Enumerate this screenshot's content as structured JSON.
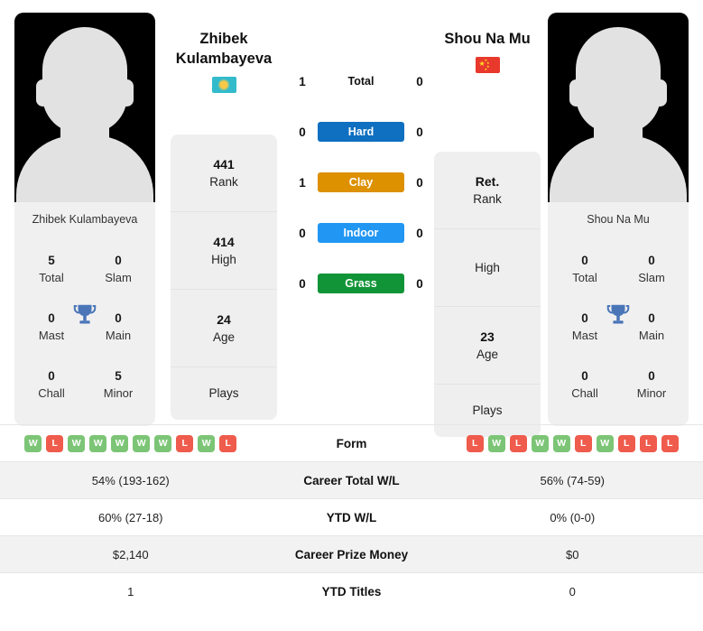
{
  "players": {
    "left": {
      "name_line1": "Zhibek",
      "name_line2": "Kulambayeva",
      "full_name": "Zhibek Kulambayeva",
      "photo_caption": "Zhibek Kulambayeva",
      "flag": "kazakhstan-flag",
      "titles": {
        "total_value": "5",
        "total_label": "Total",
        "slam_value": "0",
        "slam_label": "Slam",
        "mast_value": "0",
        "mast_label": "Mast",
        "main_value": "0",
        "main_label": "Main",
        "chall_value": "0",
        "chall_label": "Chall",
        "minor_value": "5",
        "minor_label": "Minor"
      },
      "ranks": {
        "rank_value": "441",
        "rank_label": "Rank",
        "high_value": "414",
        "high_label": "High",
        "age_value": "24",
        "age_label": "Age",
        "plays_value": "",
        "plays_label": "Plays"
      },
      "form": [
        "W",
        "L",
        "W",
        "W",
        "W",
        "W",
        "W",
        "L",
        "W",
        "L"
      ],
      "career_total_wl": "54% (193-162)",
      "ytd_wl": "60% (27-18)",
      "career_prize_money": "$2,140",
      "ytd_titles": "1"
    },
    "right": {
      "name_line1": "Shou Na Mu",
      "name_line2": "",
      "full_name": "Shou Na Mu",
      "photo_caption": "Shou Na Mu",
      "flag": "china-flag",
      "titles": {
        "total_value": "0",
        "total_label": "Total",
        "slam_value": "0",
        "slam_label": "Slam",
        "mast_value": "0",
        "mast_label": "Mast",
        "main_value": "0",
        "main_label": "Main",
        "chall_value": "0",
        "chall_label": "Chall",
        "minor_value": "0",
        "minor_label": "Minor"
      },
      "ranks": {
        "rank_value": "Ret.",
        "rank_label": "Rank",
        "high_value": "",
        "high_label": "High",
        "age_value": "23",
        "age_label": "Age",
        "plays_value": "",
        "plays_label": "Plays"
      },
      "form": [
        "L",
        "W",
        "L",
        "W",
        "W",
        "L",
        "W",
        "L",
        "L",
        "L"
      ],
      "career_total_wl": "56% (74-59)",
      "ytd_wl": "0% (0-0)",
      "career_prize_money": "$0",
      "ytd_titles": "0"
    }
  },
  "h2h": {
    "rows": [
      {
        "label": "Total",
        "left": "1",
        "right": "0",
        "color": ""
      },
      {
        "label": "Hard",
        "left": "0",
        "right": "0",
        "color": "#0f6fc0"
      },
      {
        "label": "Clay",
        "left": "1",
        "right": "0",
        "color": "#dd9000"
      },
      {
        "label": "Indoor",
        "left": "0",
        "right": "0",
        "color": "#2196f3"
      },
      {
        "label": "Grass",
        "left": "0",
        "right": "0",
        "color": "#109437"
      }
    ]
  },
  "table": {
    "labels": {
      "form": "Form",
      "career_total_wl": "Career Total W/L",
      "ytd_wl": "YTD W/L",
      "career_prize_money": "Career Prize Money",
      "ytd_titles": "YTD Titles"
    }
  },
  "colors": {
    "hard": "#0f6fc0",
    "clay": "#dd9000",
    "indoor": "#2196f3",
    "grass": "#109437",
    "win_badge": "#7cc576",
    "loss_badge": "#ef5b4c",
    "trophy": "#4a76b8"
  }
}
